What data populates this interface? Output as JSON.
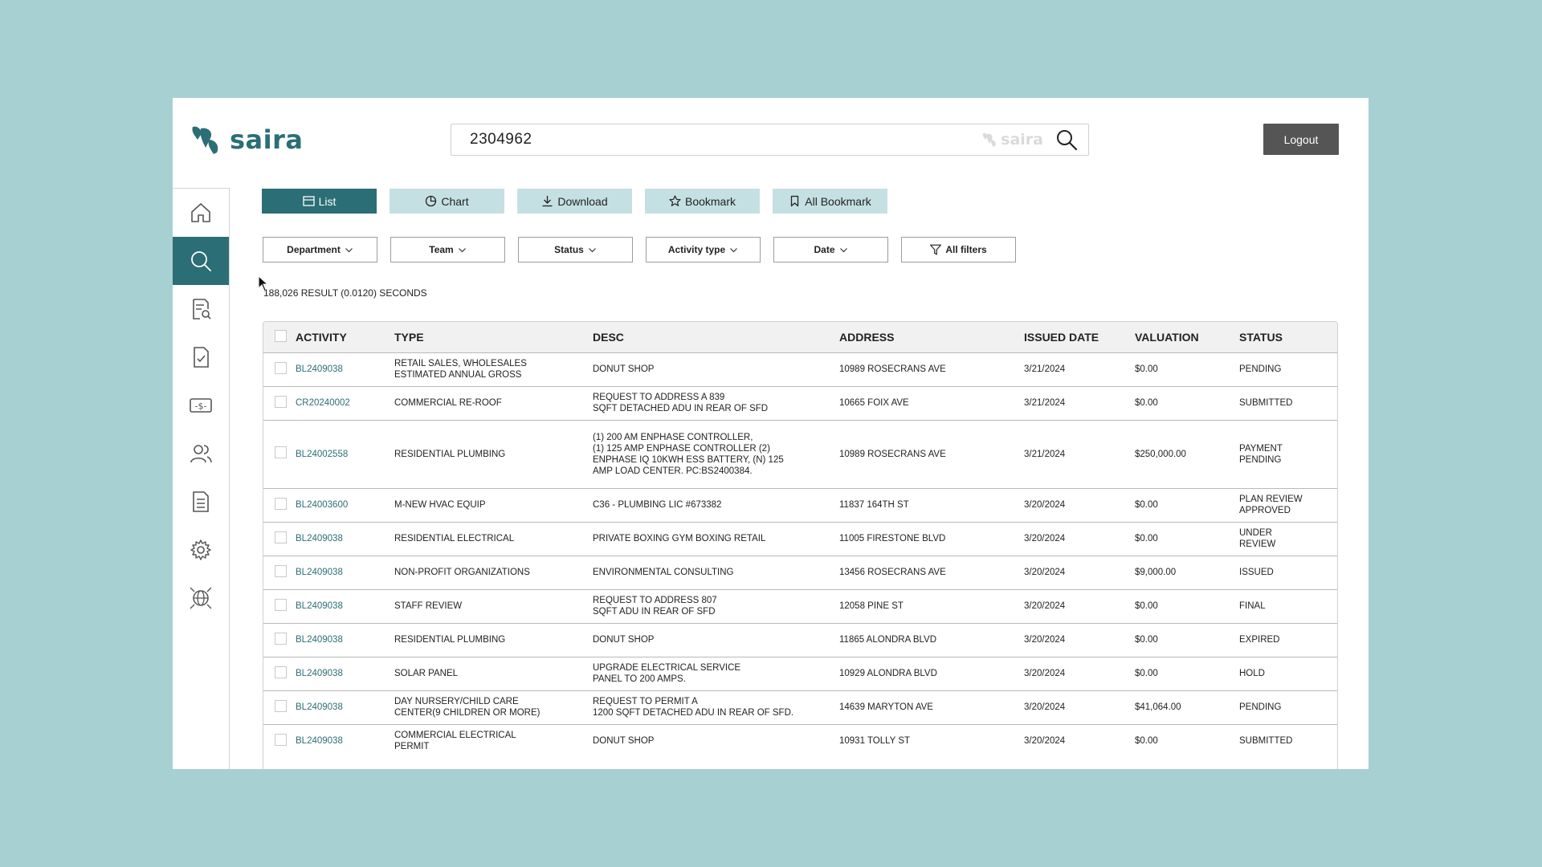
{
  "app": {
    "brand": "saira",
    "accent_color": "#2c6e75",
    "search": {
      "value": "2304962",
      "brand_watermark": "saira"
    },
    "logout_label": "Logout"
  },
  "sidebar": {
    "items": [
      {
        "name": "home-icon",
        "active": false
      },
      {
        "name": "search-icon",
        "active": true
      },
      {
        "name": "document-search-icon",
        "active": false
      },
      {
        "name": "document-check-icon",
        "active": false
      },
      {
        "name": "money-icon",
        "active": false
      },
      {
        "name": "users-icon",
        "active": false
      },
      {
        "name": "document-lines-icon",
        "active": false
      },
      {
        "name": "settings-gear-icon",
        "active": false
      },
      {
        "name": "globe-network-icon",
        "active": false
      }
    ]
  },
  "toolbar": {
    "list": "List",
    "chart": "Chart",
    "download": "Download",
    "bookmark": "Bookmark",
    "all_bookmark": "All Bookmark"
  },
  "filters": {
    "department": "Department",
    "team": "Team",
    "status": "Status",
    "activity_type": "Activity type",
    "date": "Date",
    "all_filters": "All filters"
  },
  "results": {
    "summary": "188,026 RESULT (0.0120) SECONDS"
  },
  "table": {
    "headers": {
      "activity": "ACTIVITY",
      "type": "TYPE",
      "desc": "DESC",
      "address": "ADDRESS",
      "issued_date": "ISSUED DATE",
      "valuation": "VALUATION",
      "status": "STATUS"
    },
    "rows": [
      {
        "activity": "BL2409038",
        "type": "RETAIL SALES, WHOLESALES\nESTIMATED ANNUAL GROSS",
        "desc": "DONUT SHOP",
        "address": "10989 ROSECRANS AVE",
        "issued_date": "3/21/2024",
        "valuation": "$0.00",
        "status": "PENDING"
      },
      {
        "activity": "CR20240002",
        "type": "COMMERCIAL RE-ROOF",
        "desc": "REQUEST TO ADDRESS A 839\nSQFT DETACHED ADU IN REAR OF SFD",
        "address": "10665 FOIX AVE",
        "issued_date": "3/21/2024",
        "valuation": "$0.00",
        "status": "SUBMITTED"
      },
      {
        "activity": "BL24002558",
        "type": "RESIDENTIAL PLUMBING",
        "desc": "(1) 200 AM ENPHASE CONTROLLER,\n(1) 125 AMP ENPHASE CONTROLLER (2)\nENPHASE IQ 10KWH ESS BATTERY, (N) 125\nAMP LOAD CENTER. PC:BS2400384.",
        "address": "10989 ROSECRANS AVE",
        "issued_date": "3/21/2024",
        "valuation": "$250,000.00",
        "status": "PAYMENT\nPENDING"
      },
      {
        "activity": "BL24003600",
        "type": "M-NEW HVAC EQUIP",
        "desc": "C36 - PLUMBING LIC #673382",
        "address": "11837 164TH ST",
        "issued_date": "3/20/2024",
        "valuation": "$0.00",
        "status": "PLAN REVIEW\nAPPROVED"
      },
      {
        "activity": "BL2409038",
        "type": "RESIDENTIAL ELECTRICAL",
        "desc": "PRIVATE BOXING GYM BOXING RETAIL",
        "address": "11005 FIRESTONE BLVD",
        "issued_date": "3/20/2024",
        "valuation": "$0.00",
        "status": "UNDER\nREVIEW"
      },
      {
        "activity": "BL2409038",
        "type": "NON-PROFIT ORGANIZATIONS",
        "desc": "ENVIRONMENTAL CONSULTING",
        "address": "13456 ROSECRANS AVE",
        "issued_date": "3/20/2024",
        "valuation": "$9,000.00",
        "status": "ISSUED"
      },
      {
        "activity": "BL2409038",
        "type": "STAFF REVIEW",
        "desc": "REQUEST TO ADDRESS 807\nSQFT ADU IN REAR OF SFD",
        "address": "12058 PINE ST",
        "issued_date": "3/20/2024",
        "valuation": "$0.00",
        "status": "FINAL"
      },
      {
        "activity": "BL2409038",
        "type": "RESIDENTIAL PLUMBING",
        "desc": "DONUT SHOP",
        "address": "11865 ALONDRA BLVD",
        "issued_date": "3/20/2024",
        "valuation": "$0.00",
        "status": "EXPIRED"
      },
      {
        "activity": "BL2409038",
        "type": "SOLAR PANEL",
        "desc": "UPGRADE ELECTRICAL SERVICE\n PANEL TO 200 AMPS.",
        "address": "10929 ALONDRA BLVD",
        "issued_date": "3/20/2024",
        "valuation": "$0.00",
        "status": "HOLD"
      },
      {
        "activity": "BL2409038",
        "type": "DAY NURSERY/CHILD CARE\nCENTER(9 CHILDREN OR MORE)",
        "desc": "REQUEST TO PERMIT A\n1200 SQFT DETACHED ADU IN REAR OF SFD.",
        "address": "14639 MARYTON AVE",
        "issued_date": "3/20/2024",
        "valuation": "$41,064.00",
        "status": "PENDING"
      },
      {
        "activity": "BL2409038",
        "type": "COMMERCIAL ELECTRICAL\nPERMIT",
        "desc": "DONUT SHOP",
        "address": "10931 TOLLY ST",
        "issued_date": "3/20/2024",
        "valuation": "$0.00",
        "status": "SUBMITTED"
      }
    ]
  }
}
